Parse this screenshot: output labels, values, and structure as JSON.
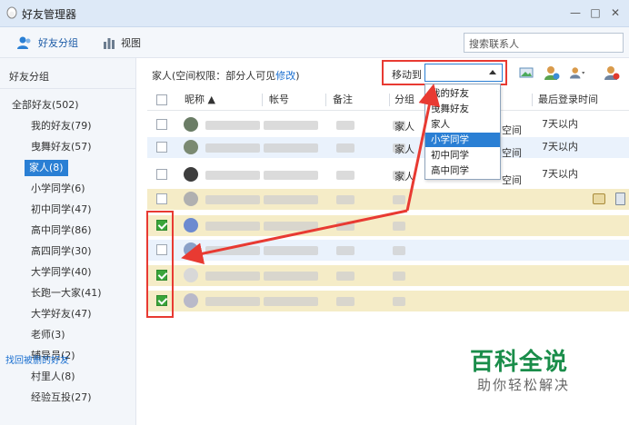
{
  "window": {
    "title": "好友管理器",
    "min_icon": "minimize-icon",
    "max_icon": "maximize-icon",
    "close_icon": "close-icon"
  },
  "toolbar": {
    "group_tab": "好友分组",
    "view_tab": "视图",
    "search_placeholder": "搜索联系人"
  },
  "sidebar": {
    "header": "好友分组",
    "root": "全部好友(502)",
    "items": [
      "我的好友(79)",
      "曳舞好友(57)",
      "家人(8)",
      "小学同学(6)",
      "初中同学(47)",
      "高中同学(86)",
      "高四同学(30)",
      "大学同学(40)",
      "长跑一大家(41)",
      "大学好友(47)",
      "老师(3)",
      "辅导员(2)",
      "村里人(8)",
      "经验互投(27)"
    ],
    "active_index": 2,
    "footer_link": "找回被删的好友"
  },
  "info": {
    "text": "家人(空间权限：部分人可见",
    "link": "修改",
    "close": ")"
  },
  "move": {
    "label": "移动到",
    "options": [
      "我的好友",
      "曳舞好友",
      "家人",
      "小学同学",
      "初中同学",
      "高中同学"
    ],
    "selected_index": 3
  },
  "table": {
    "columns": [
      "昵称 ▲",
      "帐号",
      "备注",
      "分组",
      "最后登录时间"
    ],
    "rows": [
      {
        "group": "家人",
        "extra": "空间",
        "last_login": "7天以内",
        "checked": false,
        "tone": "white"
      },
      {
        "group": "家人",
        "extra": "空间",
        "last_login": "7天以内",
        "checked": false,
        "tone": "blue"
      },
      {
        "group": "家人",
        "extra": "空间",
        "last_login": "7天以内",
        "checked": false,
        "tone": "white"
      },
      {
        "group": "",
        "extra": "",
        "last_login": "",
        "checked": false,
        "tone": "yellow"
      },
      {
        "group": "",
        "extra": "",
        "last_login": "",
        "checked": true,
        "tone": "yellow"
      },
      {
        "group": "",
        "extra": "",
        "last_login": "",
        "checked": false,
        "tone": "blue"
      },
      {
        "group": "",
        "extra": "",
        "last_login": "",
        "checked": true,
        "tone": "yellow"
      },
      {
        "group": "",
        "extra": "",
        "last_login": "",
        "checked": true,
        "tone": "yellow"
      }
    ]
  },
  "watermark": {
    "title": "百科全说",
    "subtitle": "助你轻松解决"
  },
  "colors": {
    "accent": "#2a7fd4",
    "annotation": "#e83a32",
    "watermark": "#1a8d4a"
  }
}
